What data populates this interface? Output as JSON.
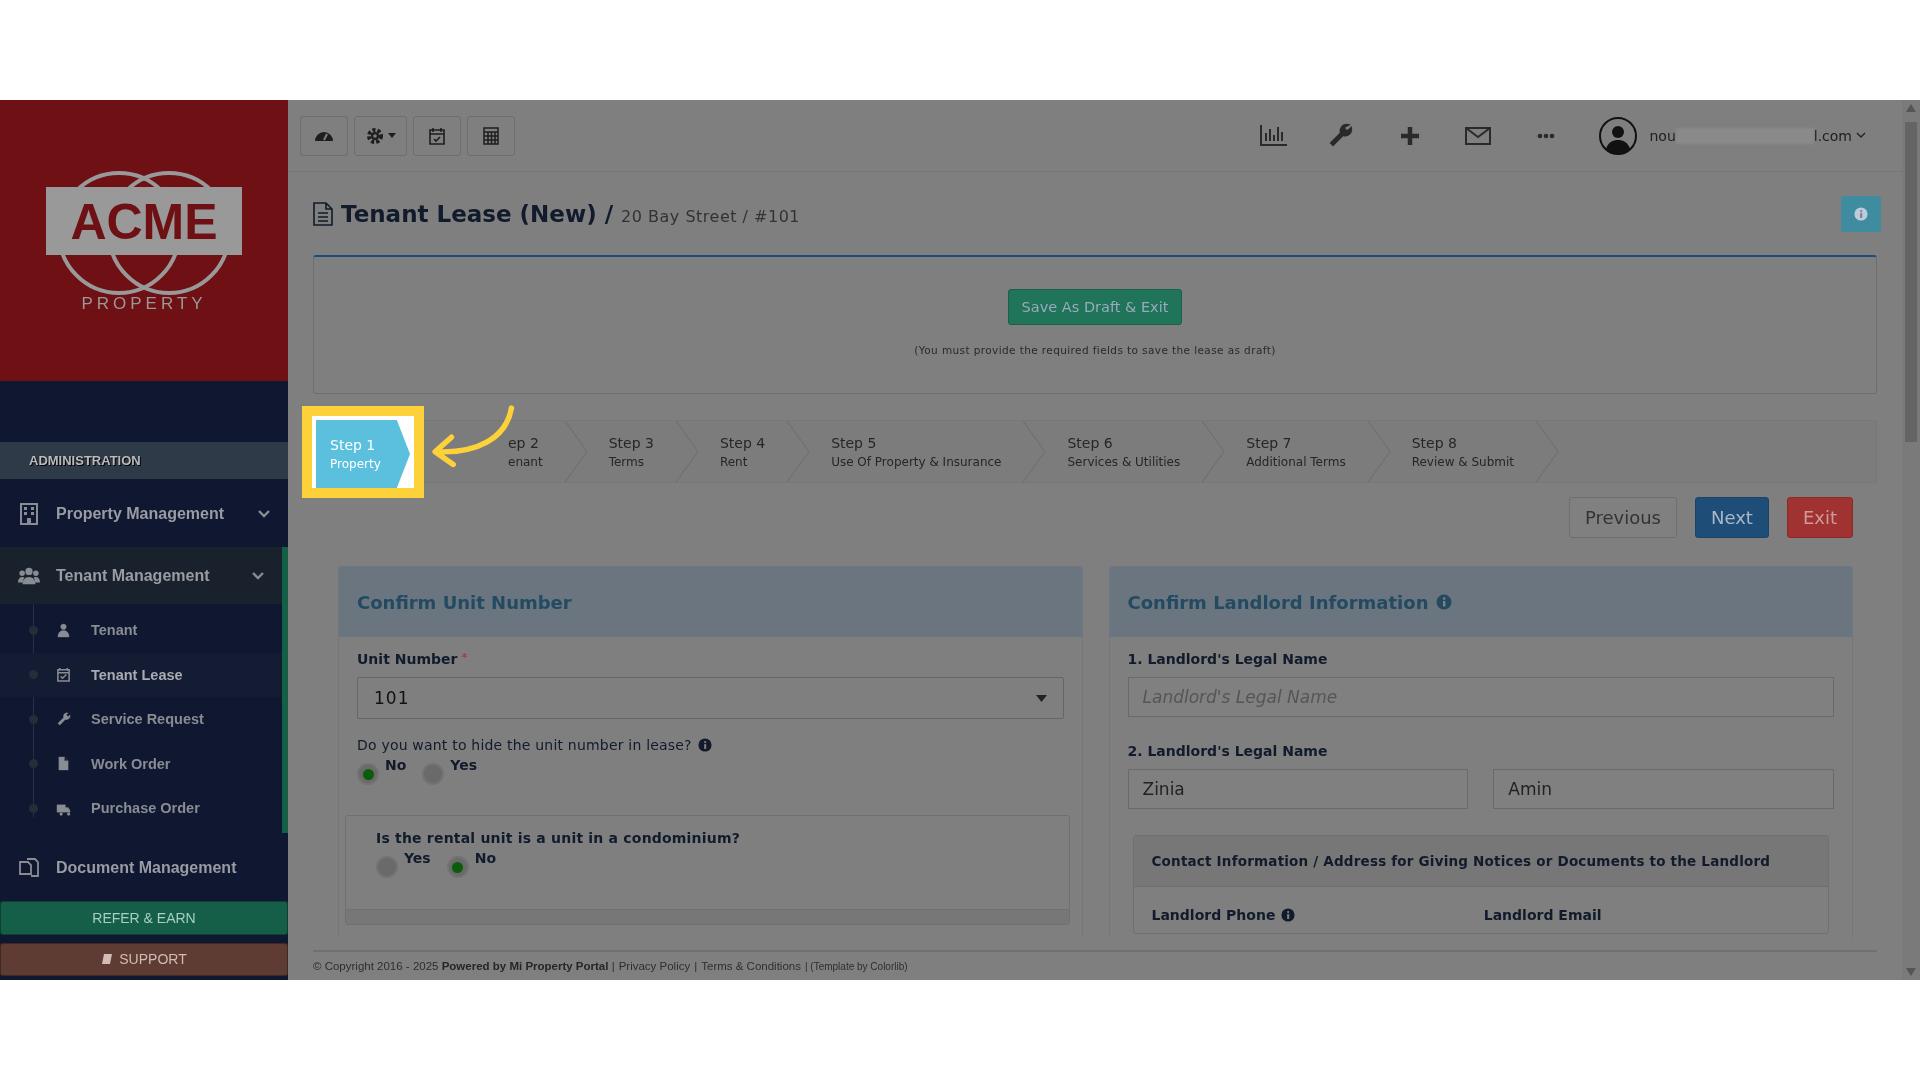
{
  "sidebar": {
    "logo": {
      "name": "ACME",
      "tagline": "PROPERTY"
    },
    "section": "ADMINISTRATION",
    "items": [
      {
        "label": "Property Management",
        "selected": false
      },
      {
        "label": "Tenant Management",
        "selected": true,
        "children": [
          {
            "label": "Tenant",
            "selected": false
          },
          {
            "label": "Tenant Lease",
            "selected": true
          },
          {
            "label": "Service Request",
            "selected": false
          },
          {
            "label": "Work Order",
            "selected": false
          },
          {
            "label": "Purchase Order",
            "selected": false
          }
        ]
      },
      {
        "label": "Document Management",
        "selected": false
      }
    ],
    "buttons": [
      {
        "label": "REFER & EARN",
        "kind": "refer"
      },
      {
        "label": "SUPPORT",
        "kind": "support"
      }
    ]
  },
  "user": {
    "email_start": "nou",
    "email_end": "l.com"
  },
  "page": {
    "title": "Tenant Lease (New) /",
    "subtitle": "20 Bay Street / #101"
  },
  "draft": {
    "button": "Save As Draft & Exit",
    "note": "(You must provide the required fields to save the lease as draft)"
  },
  "steps": [
    {
      "step": "Step 1",
      "label": "Property",
      "selected": true
    },
    {
      "step": "ep 2",
      "label": "enant",
      "selected": false
    },
    {
      "step": "Step 3",
      "label": "Terms",
      "selected": false
    },
    {
      "step": "Step 4",
      "label": "Rent",
      "selected": false
    },
    {
      "step": "Step 5",
      "label": "Use Of Property & Insurance",
      "selected": false
    },
    {
      "step": "Step 6",
      "label": "Services & Utilities",
      "selected": false
    },
    {
      "step": "Step 7",
      "label": "Additional Terms",
      "selected": false
    },
    {
      "step": "Step 8",
      "label": "Review & Submit",
      "selected": false
    }
  ],
  "nav_buttons": [
    {
      "label": "Previous",
      "kind": "default"
    },
    {
      "label": "Next",
      "kind": "primary"
    },
    {
      "label": "Exit",
      "kind": "danger"
    }
  ],
  "unit_panel": {
    "title": "Confirm Unit Number",
    "unit_label": "Unit Number",
    "unit_required": "*",
    "unit_value": "101",
    "hide_question": "Do you want to hide the unit number in lease?",
    "hide_options": [
      {
        "label": "No",
        "selected": true
      },
      {
        "label": "Yes",
        "selected": false
      }
    ],
    "condo_question": "Is the rental unit is a unit in a condominium?",
    "condo_options": [
      {
        "label": "Yes",
        "selected": false
      },
      {
        "label": "No",
        "selected": true
      }
    ]
  },
  "landlord_panel": {
    "title": "Confirm Landlord Information",
    "name1_label": "1. Landlord's Legal Name",
    "name1_placeholder": "Landlord's Legal Name",
    "name2_label": "2. Landlord's Legal Name",
    "first_name": "Zinia",
    "last_name": "Amin",
    "contact_title": "Contact Information / Address for Giving Notices or Documents to the Landlord",
    "phone_label": "Landlord Phone",
    "email_label": "Landlord Email"
  },
  "footer": [
    {
      "kind": "text",
      "text": "© Copyright 2016 - 2025 **Powered by Mi Property Portal** |"
    },
    {
      "kind": "link",
      "text": "Privacy Policy"
    },
    {
      "kind": "text",
      "text": "|"
    },
    {
      "kind": "link",
      "text": "Terms & Conditions"
    },
    {
      "kind": "small",
      "text": "| (Template by Colorlib)"
    }
  ]
}
